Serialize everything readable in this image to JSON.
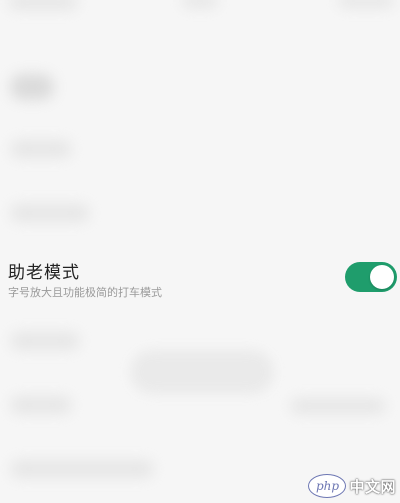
{
  "elder_mode": {
    "title": "助老模式",
    "description": "字号放大且功能极简的打车模式",
    "enabled": true,
    "toggle_color": "#1f9d6c"
  },
  "watermark": {
    "logo": "php",
    "text": "中文网"
  },
  "colors": {
    "background": "#f6f6f6",
    "title_text": "#222222",
    "description_text": "#9a9a9a"
  }
}
